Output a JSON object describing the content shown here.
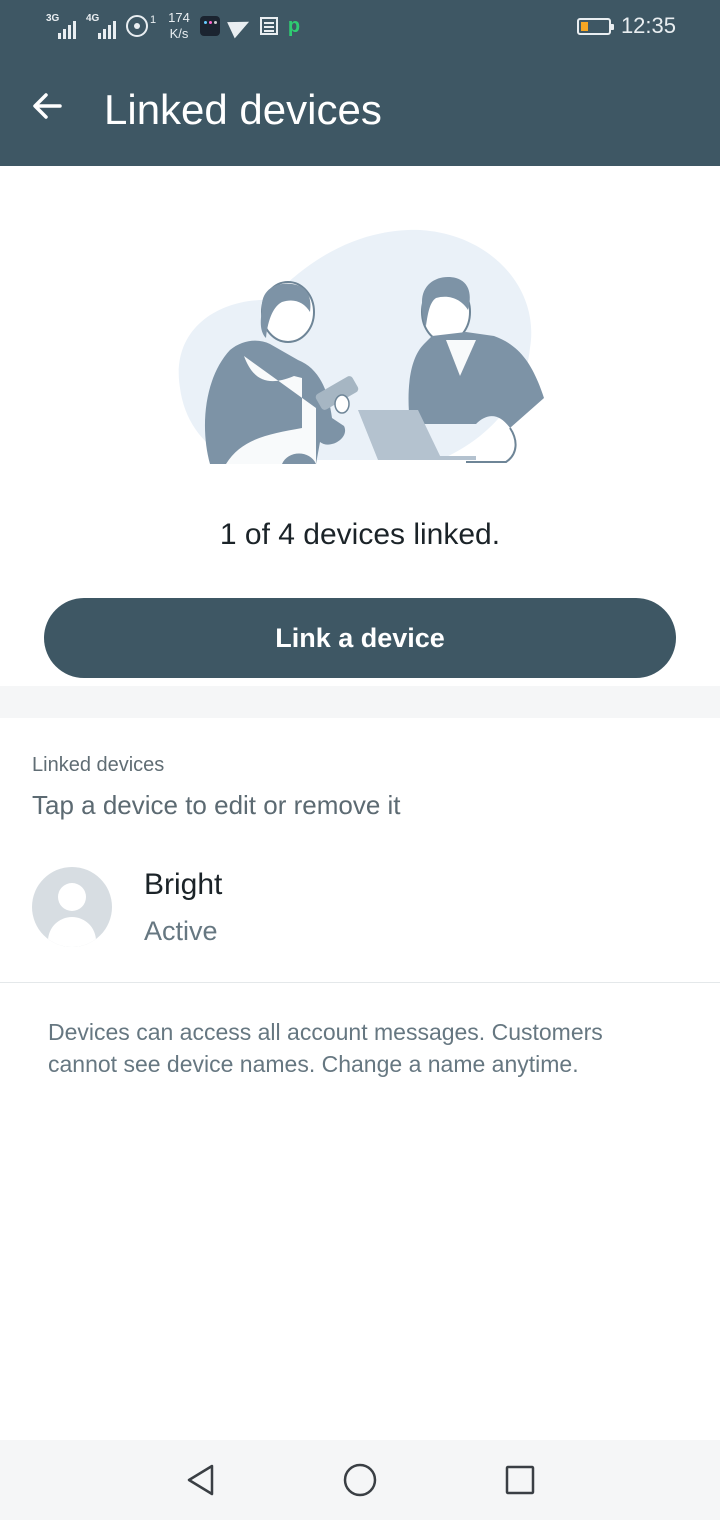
{
  "status_bar": {
    "network_1": "3G",
    "network_2": "4G",
    "hotspot_count": "1",
    "speed_value": "174",
    "speed_unit": "K/s",
    "time": "12:35",
    "battery_color": "#f5a623",
    "icons": [
      "signal-icon",
      "signal-icon",
      "hotspot-icon",
      "app-icon",
      "telegram-icon",
      "news-icon",
      "p-icon",
      "battery-icon"
    ]
  },
  "app_bar": {
    "title": "Linked devices",
    "background": "#3e5764"
  },
  "main": {
    "linked_count_text": "1 of 4 devices linked.",
    "link_button_label": "Link a device"
  },
  "linked_section": {
    "label": "Linked devices",
    "hint": "Tap a device to edit or remove it",
    "devices": [
      {
        "name": "Bright",
        "status": "Active"
      }
    ]
  },
  "footer_note": "Devices can access all account messages. Customers cannot see device names. Change a name anytime.",
  "nav": {
    "icons": [
      "back-triangle-icon",
      "home-circle-icon",
      "recent-square-icon"
    ]
  }
}
